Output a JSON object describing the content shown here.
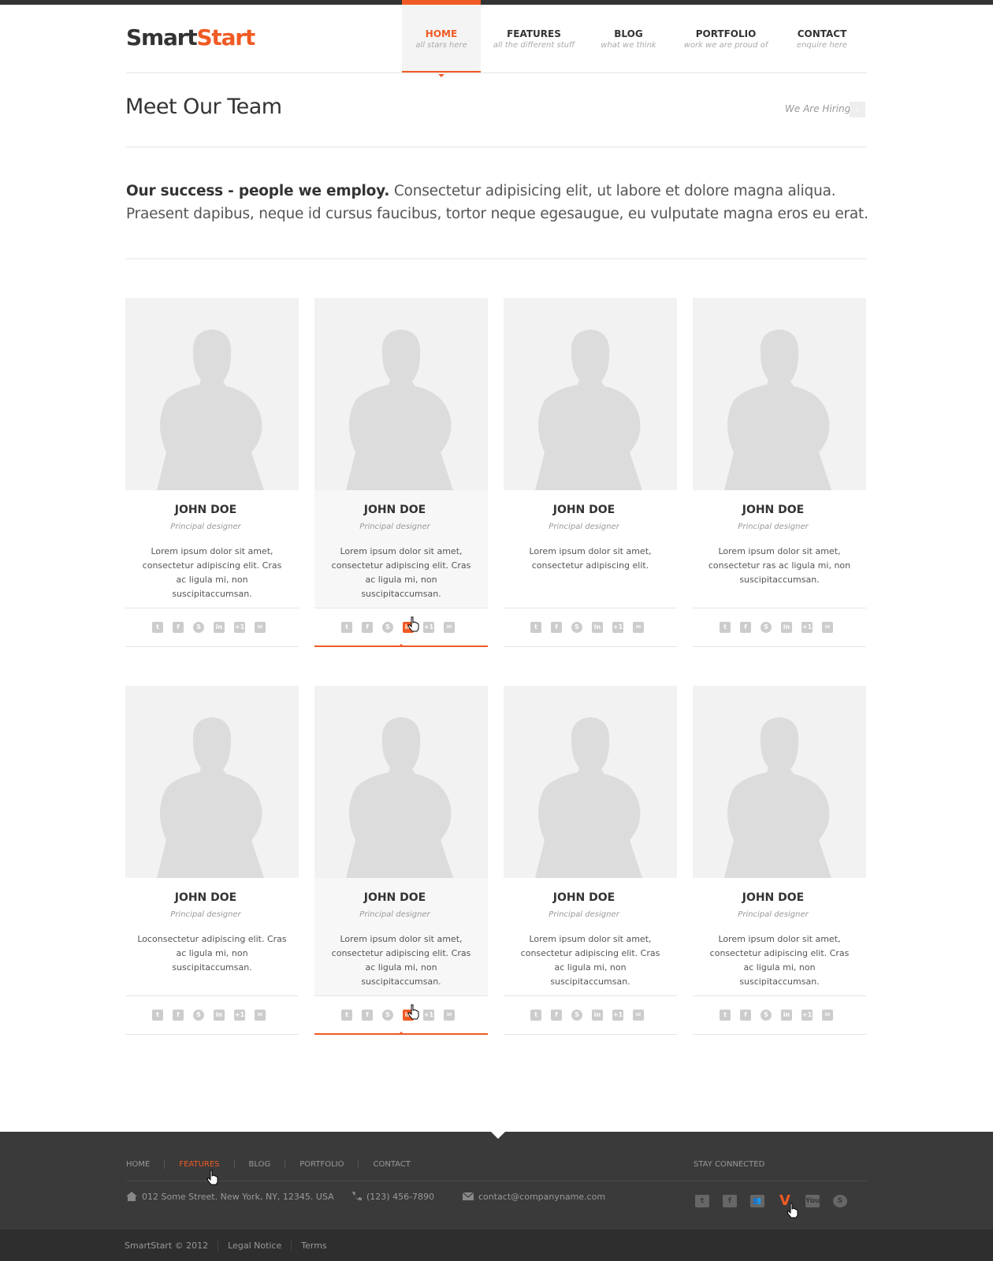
{
  "brand": {
    "part1": "Smart",
    "part2": "Start"
  },
  "nav": [
    {
      "label": "HOME",
      "sub": "all stars here"
    },
    {
      "label": "FEATURES",
      "sub": "all the different stuff"
    },
    {
      "label": "BLOG",
      "sub": "what we think"
    },
    {
      "label": "PORTFOLIO",
      "sub": "work we are proud of"
    },
    {
      "label": "CONTACT",
      "sub": "enquire here"
    }
  ],
  "page": {
    "title": "Meet Our Team",
    "hiring": "We Are Hiring"
  },
  "intro": {
    "bold": "Our success - people we employ.",
    "text": " Consectetur adipisicing elit, ut labore et dolore magna aliqua. Praesent dapibus, neque id cursus faucibus, tortor neque egesaugue, eu vulputate magna eros eu erat."
  },
  "team": [
    {
      "name": "JOHN DOE",
      "role": "Principal designer",
      "bio": "Lorem ipsum dolor sit amet, consectetur adipiscing elit. Cras ac ligula mi, non suscipitaccumsan."
    },
    {
      "name": "JOHN DOE",
      "role": "Principal designer",
      "bio": "Lorem ipsum dolor sit amet, consectetur adipiscing elit. Cras ac ligula mi, non suscipitaccumsan."
    },
    {
      "name": "JOHN DOE",
      "role": "Principal designer",
      "bio": "Lorem ipsum dolor sit amet, consectetur adipiscing elit."
    },
    {
      "name": "JOHN DOE",
      "role": "Principal designer",
      "bio": "Lorem ipsum dolor sit amet, consectetur ras ac ligula mi, non suscipitaccumsan."
    },
    {
      "name": "JOHN DOE",
      "role": "Principal designer",
      "bio": "Loconsectetur adipiscing elit. Cras ac ligula mi, non suscipitaccumsan."
    },
    {
      "name": "JOHN DOE",
      "role": "Principal designer",
      "bio": "Lorem ipsum dolor sit amet, consectetur adipiscing elit. Cras ac ligula mi, non suscipitaccumsan."
    },
    {
      "name": "JOHN DOE",
      "role": "Principal designer",
      "bio": "Lorem ipsum dolor sit amet, consectetur adipiscing elit. Cras ac ligula mi, non suscipitaccumsan."
    },
    {
      "name": "JOHN DOE",
      "role": "Principal designer",
      "bio": "Lorem ipsum dolor sit amet, consectetur adipiscing elit. Cras ac ligula mi, non suscipitaccumsan."
    }
  ],
  "social_icons": {
    "twitter": "twitter-icon",
    "facebook": "facebook-icon",
    "skype": "skype-icon",
    "linkedin": "linkedin-icon",
    "google_plus": "google-plus-icon",
    "email": "email-icon"
  },
  "social_glyphs": {
    "facebook": "f",
    "skype": "S",
    "linkedin": "in",
    "google_plus": "+1",
    "email": "✉",
    "twitter": "t"
  },
  "footer": {
    "nav": [
      "HOME",
      "FEATURES",
      "BLOG",
      "PORTFOLIO",
      "CONTACT"
    ],
    "address": "012 Some Street. New York, NY, 12345. USA",
    "phone": "(123) 456-7890",
    "email": "contact@companyname.com",
    "stay_connected": "STAY CONNECTED",
    "vimeo_glyph": "V",
    "youtube_glyph": "You",
    "copyright": "SmartStart © 2012",
    "legal": "Legal Notice",
    "terms": "Terms"
  },
  "colors": {
    "accent": "#f05a24",
    "footer_bg": "#3a3a3a",
    "bottom_bg": "#2e2e2e"
  }
}
